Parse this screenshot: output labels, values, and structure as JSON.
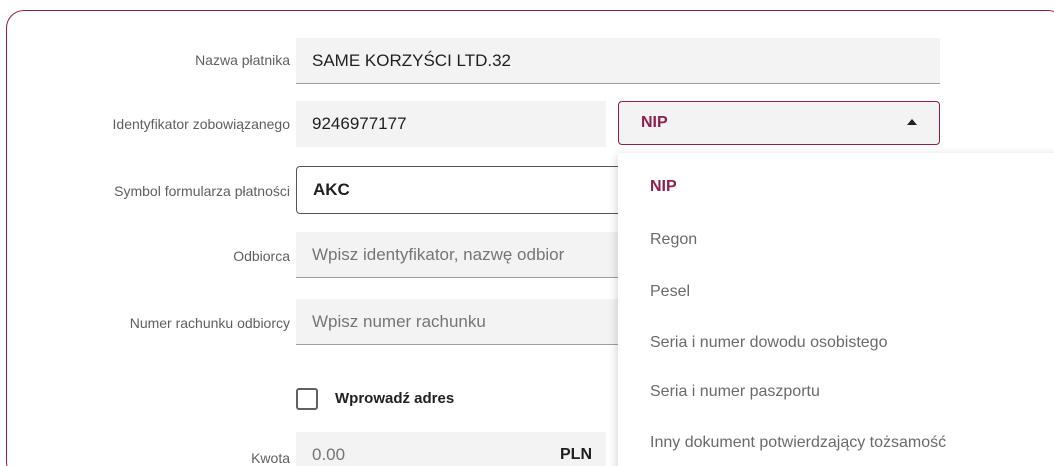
{
  "form": {
    "payer_name": {
      "label": "Nazwa płatnika",
      "value": "SAME KORZYŚCI LTD.32"
    },
    "obligor_id": {
      "label": "Identyfikator zobowiązanego",
      "value": "9246977177"
    },
    "form_symbol": {
      "label": "Symbol formularza płatności",
      "value": "AKC"
    },
    "recipient": {
      "label": "Odbiorca",
      "placeholder": "Wpisz identyfikator, nazwę odbior"
    },
    "account_number": {
      "label": "Numer rachunku odbiorcy",
      "placeholder": "Wpisz numer rachunku"
    },
    "address_checkbox": {
      "label": "Wprowadź adres",
      "checked": false
    },
    "amount": {
      "label": "Kwota",
      "value": "0.00",
      "currency": "PLN"
    }
  },
  "id_type_select": {
    "selected": "NIP",
    "options": [
      "NIP",
      "Regon",
      "Pesel",
      "Seria i numer dowodu osobistego",
      "Seria i numer paszportu",
      "Inny dokument potwierdzający tożsamość"
    ]
  },
  "colors": {
    "accent": "#8e1f4c",
    "field_bg": "#f3f3f3",
    "muted_text": "#757575"
  }
}
